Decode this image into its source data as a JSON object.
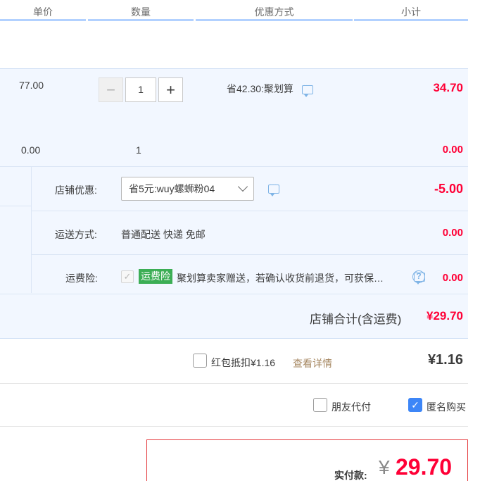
{
  "header": {
    "col_price": "单价",
    "col_qty": "数量",
    "col_promo": "优惠方式",
    "col_subtotal": "小计"
  },
  "item": {
    "unit_price": "77.00",
    "quantity": "1",
    "minus": "−",
    "plus": "+",
    "promo": "省42.30:聚划算",
    "subtotal": "34.70"
  },
  "item2": {
    "unit_price": "0.00",
    "quantity": "1",
    "subtotal": "0.00"
  },
  "shop": {
    "discount_label": "店铺优惠:",
    "discount_select": "省5元:wuy螺蛳粉04",
    "discount_value": "-5.00",
    "shipping_label": "运送方式:",
    "shipping_value": "普通配送 快递 免邮",
    "shipping_cost": "0.00",
    "insurance_label": "运费险:",
    "insurance_badge": "运费险",
    "insurance_text": "聚划算卖家赠送，若确认收货前退货，可获保险赔付",
    "insurance_cost": "0.00",
    "insurance_help": "?",
    "total_label": "店铺合计(含运费)",
    "total_value": "¥29.70"
  },
  "redpacket": {
    "label": "红包抵扣¥1.16",
    "link": "查看详情",
    "value": "¥1.16",
    "checked": false
  },
  "options": {
    "friend_pay": "朋友代付",
    "friend_pay_checked": false,
    "anonymous": "匿名购买",
    "anonymous_checked": true,
    "check_mark": "✓"
  },
  "payment": {
    "label": "实付款:",
    "currency": "¥",
    "amount": "29.70"
  },
  "colors": {
    "accent_red": "#ff0036",
    "header_border": "#b2d1ff",
    "light_blue_bg": "#f2f7ff",
    "badge_green": "#3cae55",
    "checkbox_blue": "#3d86f7",
    "link_brown": "#a68761"
  }
}
